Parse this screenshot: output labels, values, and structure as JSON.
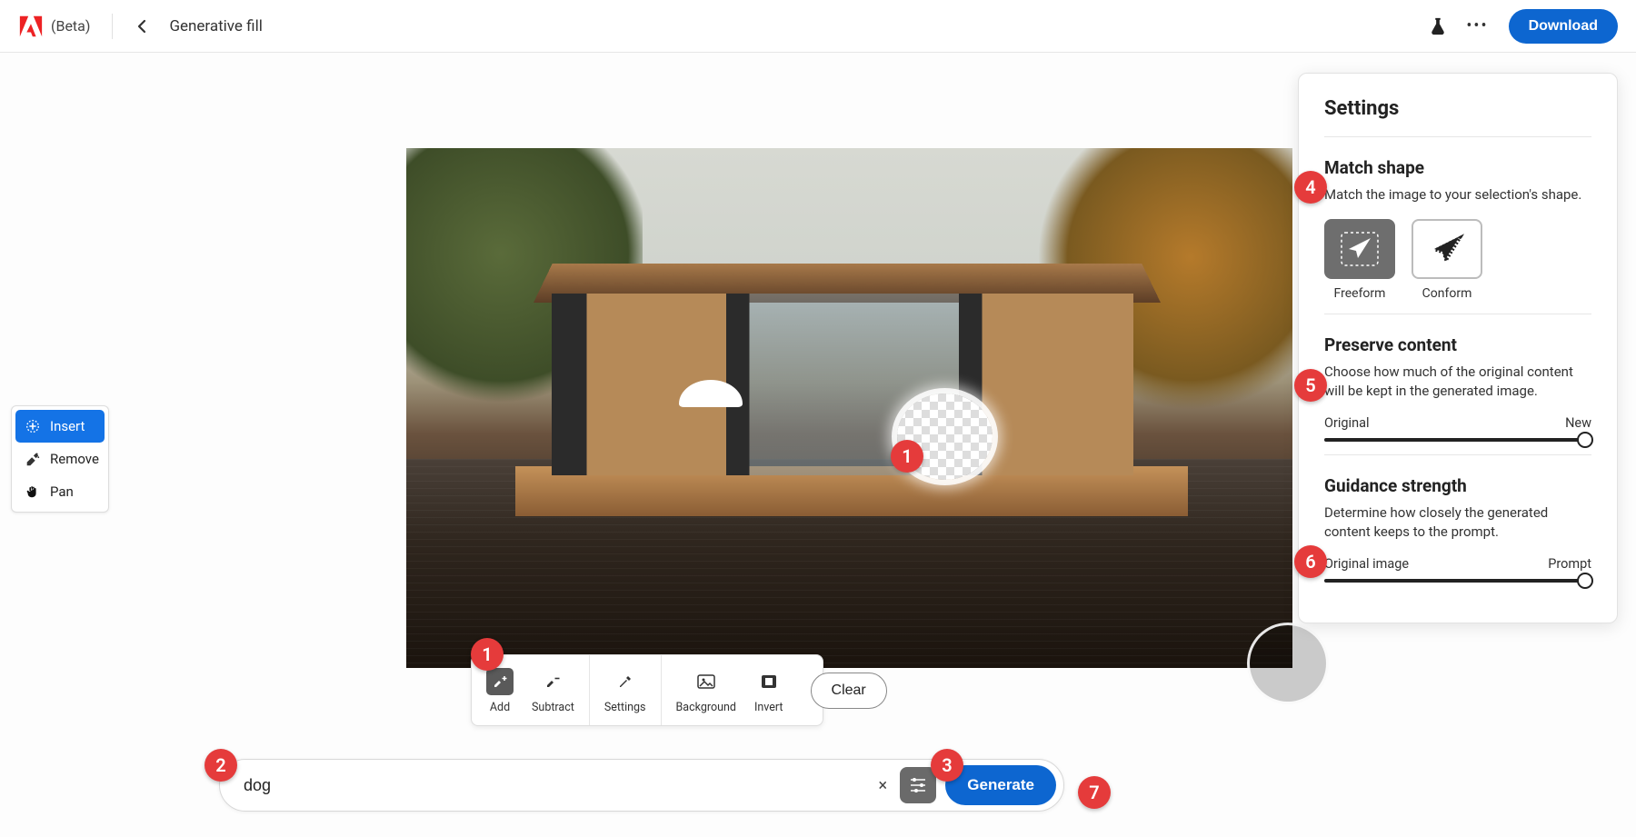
{
  "header": {
    "beta_label": "(Beta)",
    "page_title": "Generative fill",
    "download_label": "Download"
  },
  "tools": {
    "insert": "Insert",
    "remove": "Remove",
    "pan": "Pan"
  },
  "brush_toolbar": {
    "add": "Add",
    "subtract": "Subtract",
    "settings": "Settings",
    "background": "Background",
    "invert": "Invert",
    "clear": "Clear"
  },
  "prompt": {
    "value": "dog",
    "generate_label": "Generate"
  },
  "settings_panel": {
    "title": "Settings",
    "match_shape": {
      "heading": "Match shape",
      "desc": "Match the image to your selection's shape.",
      "freeform": "Freeform",
      "conform": "Conform"
    },
    "preserve_content": {
      "heading": "Preserve content",
      "desc": "Choose how much of the original content will be kept in the generated image.",
      "left": "Original",
      "right": "New"
    },
    "guidance": {
      "heading": "Guidance strength",
      "desc": "Determine how closely the generated content keeps to the prompt.",
      "left": "Original image",
      "right": "Prompt"
    }
  },
  "badges": {
    "b1": "1",
    "b1b": "1",
    "b2": "2",
    "b3": "3",
    "b4": "4",
    "b5": "5",
    "b6": "6",
    "b7": "7"
  }
}
